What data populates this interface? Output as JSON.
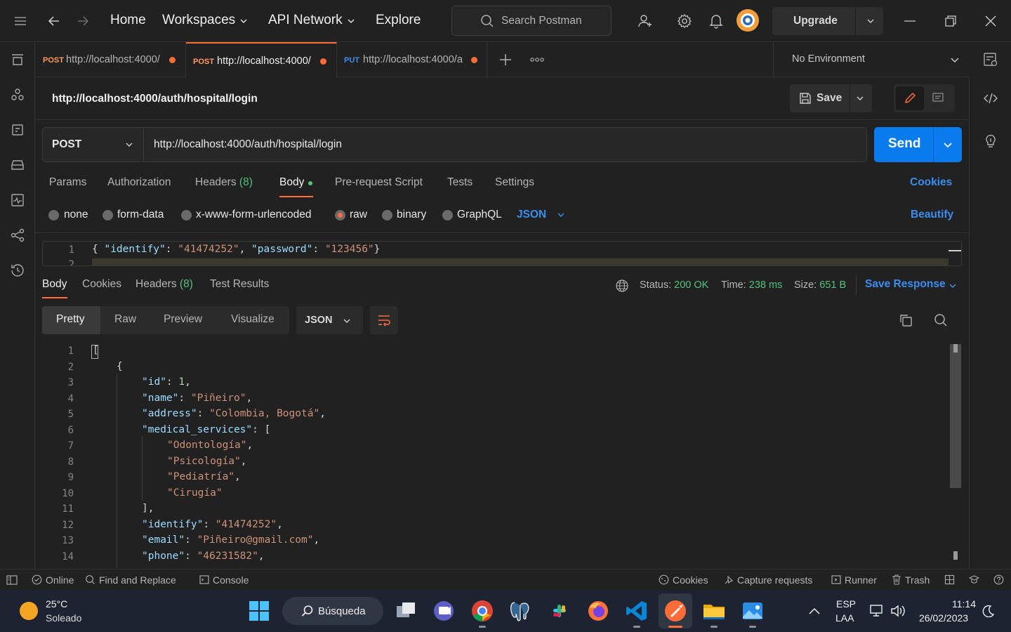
{
  "topbar": {
    "nav": {
      "home": "Home",
      "workspaces": "Workspaces",
      "api_network": "API Network",
      "explore": "Explore"
    },
    "search_placeholder": "Search Postman",
    "upgrade": "Upgrade"
  },
  "tabs": [
    {
      "method": "POST",
      "url": "http://localhost:4000/",
      "active": false
    },
    {
      "method": "POST",
      "url": "http://localhost:4000/",
      "active": true
    },
    {
      "method": "PUT",
      "url": "http://localhost:4000/a",
      "active": false
    }
  ],
  "environment": "No Environment",
  "request": {
    "title": "http://localhost:4000/auth/hospital/login",
    "save": "Save",
    "method": "POST",
    "url": "http://localhost:4000/auth/hospital/login",
    "send": "Send",
    "tabs": {
      "params": "Params",
      "authorization": "Authorization",
      "headers": "Headers",
      "headers_count": "(8)",
      "body": "Body",
      "prerequest": "Pre-request Script",
      "tests": "Tests",
      "settings": "Settings"
    },
    "cookies": "Cookies",
    "body_types": {
      "none": "none",
      "form_data": "form-data",
      "urlencoded": "x-www-form-urlencoded",
      "raw": "raw",
      "binary": "binary",
      "graphql": "GraphQL",
      "format": "JSON"
    },
    "selected_body_type": "raw",
    "beautify": "Beautify",
    "body_line_numbers": [
      "1",
      "2"
    ],
    "body_code": {
      "k1": "\"identify\"",
      "v1": "\"41474252\"",
      "k2": "\"password\"",
      "v2": "\"123456\""
    }
  },
  "response": {
    "tabs": {
      "body": "Body",
      "cookies": "Cookies",
      "headers": "Headers",
      "headers_count": "(8)",
      "tests": "Test Results"
    },
    "status_label": "Status:",
    "status": "200 OK",
    "time_label": "Time:",
    "time": "238 ms",
    "size_label": "Size:",
    "size": "651 B",
    "save_response": "Save Response",
    "views": {
      "pretty": "Pretty",
      "raw": "Raw",
      "preview": "Preview",
      "visualize": "Visualize",
      "format": "JSON"
    },
    "line_numbers": [
      "1",
      "2",
      "3",
      "4",
      "5",
      "6",
      "7",
      "8",
      "9",
      "10",
      "11",
      "12",
      "13",
      "14"
    ],
    "json": {
      "id_key": "\"id\"",
      "id_val": "1",
      "name_key": "\"name\"",
      "name_val": "\"Piñeiro\"",
      "address_key": "\"address\"",
      "address_val": "\"Colombia, Bogotá\"",
      "ms_key": "\"medical_services\"",
      "services": [
        "\"Odontología\"",
        "\"Psicología\"",
        "\"Pediatría\"",
        "\"Cirugía\""
      ],
      "identify_key": "\"identify\"",
      "identify_val": "\"41474252\"",
      "email_key": "\"email\"",
      "email_val": "\"Piñeiro@gmail.com\"",
      "phone_key": "\"phone\"",
      "phone_val": "\"46231582\""
    }
  },
  "statusbar": {
    "online": "Online",
    "find": "Find and Replace",
    "console": "Console",
    "cookies": "Cookies",
    "capture": "Capture requests",
    "runner": "Runner",
    "trash": "Trash"
  },
  "taskbar": {
    "weather_temp": "25°C",
    "weather_desc": "Soleado",
    "search": "Búsqueda",
    "lang1": "ESP",
    "lang2": "LAA",
    "time": "11:14",
    "date": "26/02/2023"
  },
  "colors": {
    "accent_orange": "#ff6c37",
    "primary_blue": "#097bed",
    "link_blue": "#3b8ef0",
    "success_green": "#52c27a"
  }
}
